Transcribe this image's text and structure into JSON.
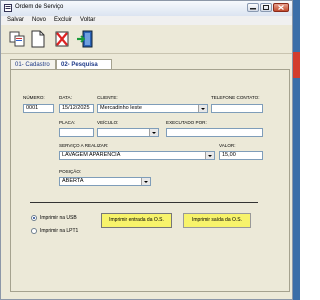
{
  "window": {
    "title": "Ordem de Serviço"
  },
  "menu": [
    "Salvar",
    "Novo",
    "Excluir",
    "Voltar"
  ],
  "toolbar": {
    "icons": [
      "copy-icon",
      "new-document-icon",
      "delete-icon",
      "exit-icon"
    ]
  },
  "tabs": [
    {
      "label": "01- Cadastro"
    },
    {
      "label": "02- Pesquisa"
    }
  ],
  "form": {
    "numero": {
      "label": "NÚMERO:",
      "value": "0001"
    },
    "data": {
      "label": "DATA:",
      "value": "15/12/2025"
    },
    "cliente": {
      "label": "CLIENTE:",
      "value": "Mercadinho leste"
    },
    "telefone": {
      "label": "TELEFONE CONTATO:",
      "value": ""
    },
    "placa": {
      "label": "PLACA:",
      "value": ""
    },
    "veiculo": {
      "label": "VEÍCULO:",
      "value": ""
    },
    "executado_por": {
      "label": "EXECUTADO POR:",
      "value": ""
    },
    "servico": {
      "label": "SERVIÇO A REALIZAR:",
      "value": "LAVAGEM APARÊNCIA"
    },
    "valor": {
      "label": "VALOR:",
      "value": "15,00"
    },
    "posicao": {
      "label": "POSIÇÃO:",
      "value": "ABERTA"
    }
  },
  "print": {
    "options": [
      {
        "label": "Imprimir na USB",
        "checked": true
      },
      {
        "label": "Imprimir na LPT1",
        "checked": false
      }
    ],
    "btn_entrada": "Imprimir entrada da O.S.",
    "btn_saida": "Imprimir saída da O.S."
  },
  "colors": {
    "print_button": "#f7f36b",
    "window_bg": "#ece9d8"
  }
}
